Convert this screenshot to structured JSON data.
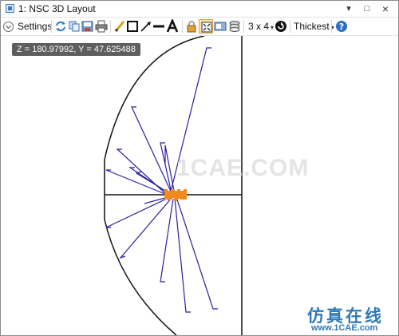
{
  "window": {
    "title": "1: NSC 3D Layout",
    "minimize_glyph": "▾",
    "restore_glyph": "□",
    "close_glyph": "×"
  },
  "toolbar": {
    "settings_label": "Settings",
    "layout_label": "3 x 4",
    "layout_caret": "▾",
    "thickness_label": "Thickest",
    "thickness_caret": "▾",
    "icons": [
      "refresh-icon",
      "copy-icon",
      "save-icon",
      "print-icon",
      "pencil-icon",
      "rectangle-icon",
      "arrow-icon",
      "line-icon",
      "text-icon",
      "lock-icon",
      "fit-icon",
      "snapshot-icon",
      "layers-icon",
      "rotate-icon",
      "help-icon"
    ]
  },
  "coordinate_readout": "Z = 180.97992, Y = 47.625488",
  "watermark": {
    "center": "1CAE.COM",
    "chinese": "仿真在线",
    "url": "www.1CAE.com"
  },
  "colors": {
    "ray": "#2a1f9e",
    "source": "#f08a1e",
    "geometry": "#111111",
    "tooltip": "#5e5e5e",
    "watermark": "#2f79b8"
  }
}
